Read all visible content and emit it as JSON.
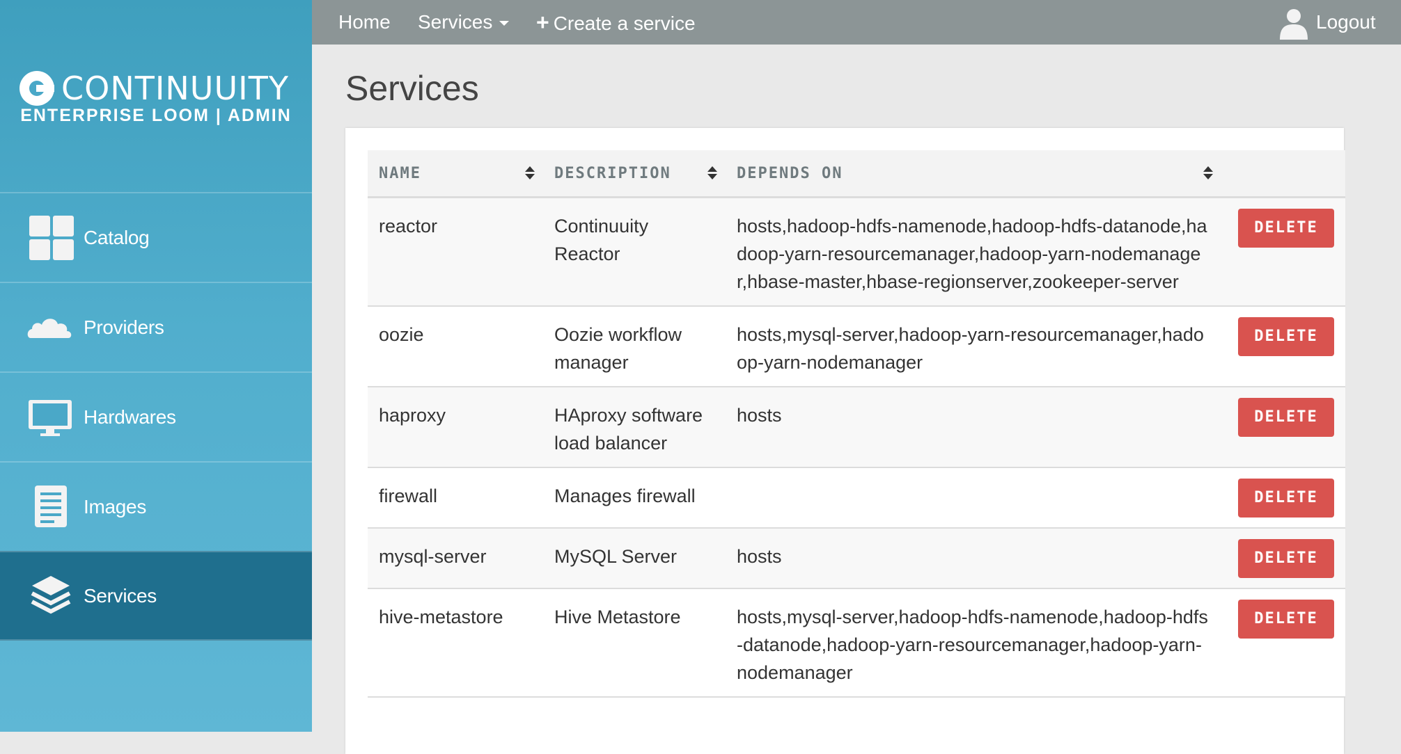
{
  "brand": {
    "name": "CONTINUUITY",
    "subtitle": "ENTERPRISE LOOM | ADMIN"
  },
  "sidebar": {
    "items": [
      {
        "label": "Catalog",
        "icon": "grid-icon"
      },
      {
        "label": "Providers",
        "icon": "cloud-icon"
      },
      {
        "label": "Hardwares",
        "icon": "monitor-icon"
      },
      {
        "label": "Images",
        "icon": "document-icon"
      },
      {
        "label": "Services",
        "icon": "layers-icon",
        "active": true
      }
    ]
  },
  "topbar": {
    "home": "Home",
    "services": "Services",
    "create": "Create a service",
    "logout": "Logout"
  },
  "page": {
    "title": "Services"
  },
  "table": {
    "headers": {
      "name": "NAME",
      "description": "DESCRIPTION",
      "depends_on": "DEPENDS ON"
    },
    "delete_label": "DELETE",
    "rows": [
      {
        "name": "reactor",
        "description": "Continuuity Reactor",
        "depends_on": "hosts,hadoop-hdfs-namenode,hadoop-hdfs-datanode,hadoop-yarn-resourcemanager,hadoop-yarn-nodemanager,hbase-master,hbase-regionserver,zookeeper-server"
      },
      {
        "name": "oozie",
        "description": "Oozie workflow manager",
        "depends_on": "hosts,mysql-server,hadoop-yarn-resourcemanager,hadoop-yarn-nodemanager"
      },
      {
        "name": "haproxy",
        "description": "HAproxy software load balancer",
        "depends_on": "hosts"
      },
      {
        "name": "firewall",
        "description": "Manages firewall",
        "depends_on": ""
      },
      {
        "name": "mysql-server",
        "description": "MySQL Server",
        "depends_on": "hosts"
      },
      {
        "name": "hive-metastore",
        "description": "Hive Metastore",
        "depends_on": "hosts,mysql-server,hadoop-hdfs-namenode,hadoop-hdfs-datanode,hadoop-yarn-resourcemanager,hadoop-yarn-nodemanager"
      }
    ]
  },
  "colors": {
    "sidebar": "#4aa8c8",
    "sidebar_active": "#1f6f8e",
    "topbar": "#8c9596",
    "delete": "#d9534f"
  }
}
